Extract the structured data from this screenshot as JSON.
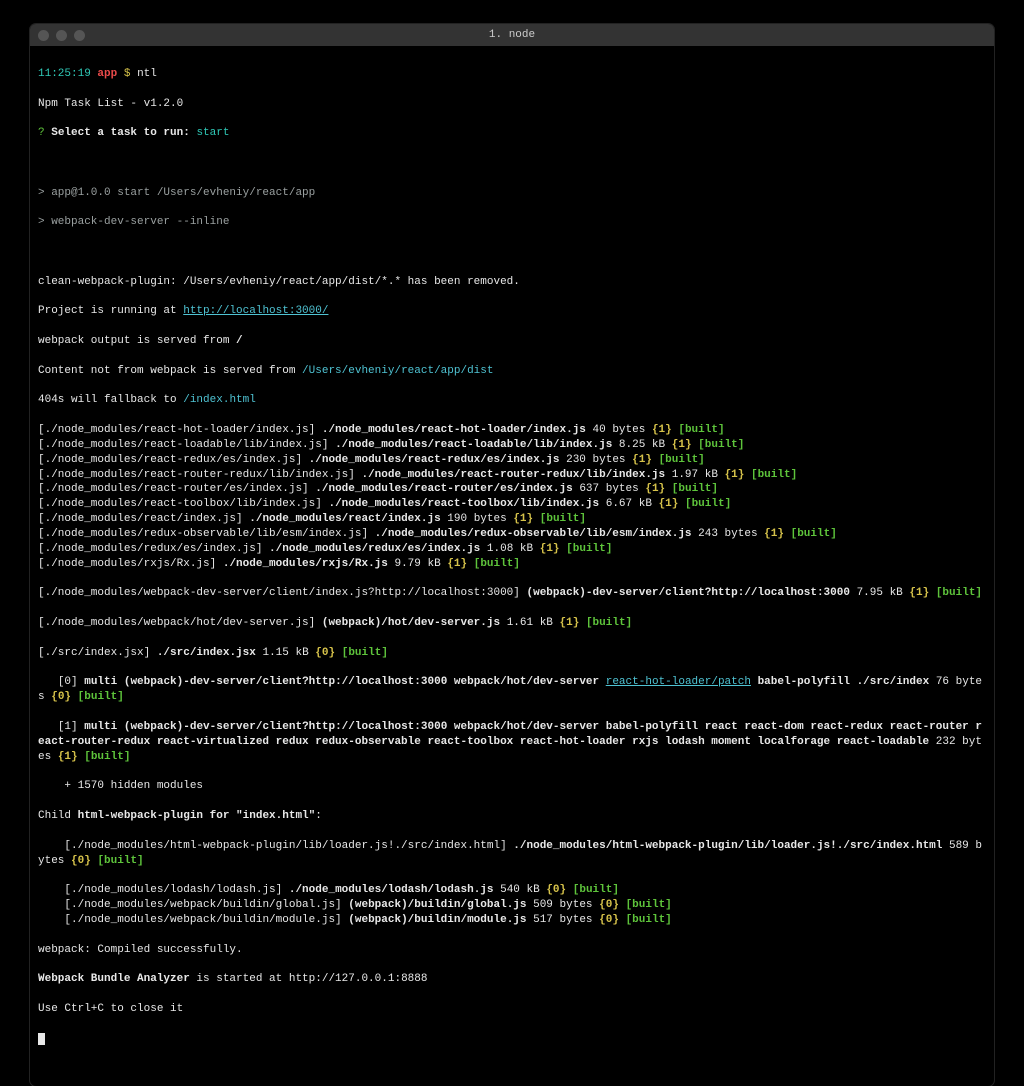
{
  "window": {
    "title": "1. node"
  },
  "prompt": {
    "time": "11:25:19",
    "dir": "app",
    "symbol": "$",
    "command": "ntl"
  },
  "ntl": {
    "header": "Npm Task List - v1.2.0",
    "q_mark": "?",
    "q_label": "Select a task to run:",
    "selected": "start"
  },
  "exec": {
    "line1": "> app@1.0.0 start /Users/evheniy/react/app",
    "line2": "> webpack-dev-server --inline"
  },
  "pre": {
    "clean": "clean-webpack-plugin: /Users/evheniy/react/app/dist/*.* has been removed.",
    "running_pre": "Project is running at ",
    "running_url": "http://localhost:3000/",
    "served_from_pre": "webpack output is served from ",
    "served_from_path": "/",
    "notfrom_pre": "Content not from webpack is served from ",
    "notfrom_path": "/Users/evheniy/react/app/dist",
    "fallback_pre": "404s will fallback to ",
    "fallback_path": "/index.html"
  },
  "modules": [
    {
      "src": "[./node_modules/react-hot-loader/index.js]",
      "name": "./node_modules/react-hot-loader/index.js",
      "size": "40 bytes",
      "idx": "{1}"
    },
    {
      "src": "[./node_modules/react-loadable/lib/index.js]",
      "name": "./node_modules/react-loadable/lib/index.js",
      "size": "8.25 kB",
      "idx": "{1}"
    },
    {
      "src": "[./node_modules/react-redux/es/index.js]",
      "name": "./node_modules/react-redux/es/index.js",
      "size": "230 bytes",
      "idx": "{1}"
    },
    {
      "src": "[./node_modules/react-router-redux/lib/index.js]",
      "name": "./node_modules/react-router-redux/lib/index.js",
      "size": "1.97 kB",
      "idx": "{1}"
    },
    {
      "src": "[./node_modules/react-router/es/index.js]",
      "name": "./node_modules/react-router/es/index.js",
      "size": "637 bytes",
      "idx": "{1}"
    },
    {
      "src": "[./node_modules/react-toolbox/lib/index.js]",
      "name": "./node_modules/react-toolbox/lib/index.js",
      "size": "6.67 kB",
      "idx": "{1}"
    },
    {
      "src": "[./node_modules/react/index.js]",
      "name": "./node_modules/react/index.js",
      "size": "190 bytes",
      "idx": "{1}"
    },
    {
      "src": "[./node_modules/redux-observable/lib/esm/index.js]",
      "name": "./node_modules/redux-observable/lib/esm/index.js",
      "size": "243 bytes",
      "idx": "{1}"
    },
    {
      "src": "[./node_modules/redux/es/index.js]",
      "name": "./node_modules/redux/es/index.js",
      "size": "1.08 kB",
      "idx": "{1}"
    },
    {
      "src": "[./node_modules/rxjs/Rx.js]",
      "name": "./node_modules/rxjs/Rx.js",
      "size": "9.79 kB",
      "idx": "{1}"
    }
  ],
  "wds": {
    "src": "[./node_modules/webpack-dev-server/client/index.js?http://localhost:3000]",
    "name": "(webpack)-dev-server/client?http://localhost:3000",
    "size": "7.95 kB",
    "idx": "{1}"
  },
  "hot": {
    "src": "[./node_modules/webpack/hot/dev-server.js]",
    "name": "(webpack)/hot/dev-server.js",
    "size": "1.61 kB",
    "idx": "{1}"
  },
  "srcindex": {
    "src": "[./src/index.jsx]",
    "name": "./src/index.jsx",
    "size": "1.15 kB",
    "idx": "{0}"
  },
  "multi0": {
    "idx": "   [0]",
    "text_pre": "multi (webpack)-dev-server/client?http://localhost:3000 webpack/hot/dev-server ",
    "link": "react-hot-loader/patch",
    "text_post": " babel-polyfill ./src/index",
    "size": "76 bytes",
    "idxb": "{0}"
  },
  "multi1": {
    "idx": "   [1]",
    "text": "multi (webpack)-dev-server/client?http://localhost:3000 webpack/hot/dev-server babel-polyfill react react-dom react-redux react-router react-router-redux react-virtualized redux redux-observable react-toolbox react-hot-loader rxjs lodash moment localforage react-loadable",
    "size": "232 bytes",
    "idxb": "{1}"
  },
  "hidden": "    + 1570 hidden modules",
  "child": {
    "pre": "Child ",
    "label": "html-webpack-plugin for \"index.html\"",
    "colon": ":",
    "src": "    [./node_modules/html-webpack-plugin/lib/loader.js!./src/index.html]",
    "name": "./node_modules/html-webpack-plugin/lib/loader.js!./src/index.html",
    "size": "589 bytes",
    "idxb": "{0}"
  },
  "childmods": [
    {
      "src": "    [./node_modules/lodash/lodash.js]",
      "name": "./node_modules/lodash/lodash.js",
      "size": "540 kB",
      "idx": "{0}"
    },
    {
      "src": "    [./node_modules/webpack/buildin/global.js]",
      "name": "(webpack)/buildin/global.js",
      "size": "509 bytes",
      "idx": "{0}"
    },
    {
      "src": "    [./node_modules/webpack/buildin/module.js]",
      "name": "(webpack)/buildin/module.js",
      "size": "517 bytes",
      "idx": "{0}"
    }
  ],
  "final": {
    "compiled": "webpack: Compiled successfully.",
    "wba_pre": "Webpack Bundle Analyzer",
    "wba_post": " is started at http://127.0.0.1:8888",
    "close": "Use Ctrl+C to close it"
  },
  "built": "[built]",
  "open_b": "[",
  "close_b": "]"
}
